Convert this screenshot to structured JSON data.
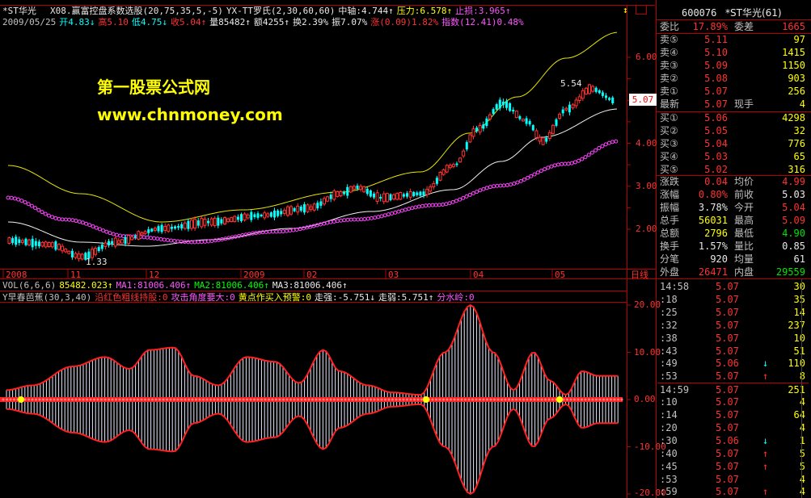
{
  "header": {
    "stock_name": "*ST华光",
    "indicator_line": [
      {
        "text": "X08.赢富控盘系数选股(20,75,35,5,-5)",
        "color": "#e8e8e8"
      },
      {
        "text": "YX-TT罗氏(2,30,60,60)",
        "color": "#e8e8e8"
      },
      {
        "text": "中轴:4.744↑",
        "color": "#e8e8e8"
      },
      {
        "text": "压力:6.578↑",
        "color": "#ffff00"
      },
      {
        "text": "止损:3.965↑",
        "color": "#ff55ff"
      }
    ],
    "ohlc_line": [
      {
        "text": "2009/05/25",
        "color": "#c0c0c0"
      },
      {
        "text": "开4.83↓",
        "color": "#00ffff"
      },
      {
        "text": "高5.10",
        "color": "#ff3232"
      },
      {
        "text": "低4.75↓",
        "color": "#00ffff"
      },
      {
        "text": "收5.04↑",
        "color": "#ff3232"
      },
      {
        "text": "量85482↑",
        "color": "#e8e8e8"
      },
      {
        "text": "额4255↑",
        "color": "#e8e8e8"
      },
      {
        "text": "换2.39%",
        "color": "#e8e8e8"
      },
      {
        "text": "振7.07%",
        "color": "#e8e8e8"
      },
      {
        "text": "涨(0.09)1.82%",
        "color": "#ff3232"
      },
      {
        "text": "指数(12.41)0.48%",
        "color": "#ff55ff"
      }
    ]
  },
  "watermark": {
    "line1": "第一股票公式网",
    "line2": "www.chnmoney.com"
  },
  "price_axis": {
    "labels": [
      "6.00",
      "5.00",
      "4.00",
      "3.00",
      "2.00"
    ],
    "current_price_tag": "5.07",
    "high_marker": "5.54",
    "low_marker": "1.33"
  },
  "date_axis": {
    "labels": [
      "2008",
      "11",
      "12",
      "2009",
      "02",
      "03",
      "04",
      "05"
    ],
    "period_label": "日线"
  },
  "volume_line": [
    {
      "text": "VOL(6,6,6)",
      "color": "#c0c0c0"
    },
    {
      "text": "85482.023↑",
      "color": "#ffff00"
    },
    {
      "text": "MA1:81006.406↑",
      "color": "#ff55ff"
    },
    {
      "text": "MA2:81006.406↑",
      "color": "#00ff00"
    },
    {
      "text": "MA3:81006.406↑",
      "color": "#e8e8e8"
    }
  ],
  "sub_indicator_line": [
    {
      "text": "Y早春芭蕉(30,3,40)",
      "color": "#c0c0c0"
    },
    {
      "text": "沿红色粗线持股:0",
      "color": "#ff3232"
    },
    {
      "text": "攻击角度要大:0",
      "color": "#ff55ff"
    },
    {
      "text": "黄点作买入预警:0",
      "color": "#ffff00"
    },
    {
      "text": "走强:-5.751↓",
      "color": "#e8e8e8"
    },
    {
      "text": "走弱:5.751↑",
      "color": "#e8e8e8"
    },
    {
      "text": "分水岭:0",
      "color": "#ff55ff"
    }
  ],
  "sub_axis": {
    "labels": [
      "20.00",
      "10.00",
      "0.00",
      "-10.00",
      "-20.00"
    ]
  },
  "quote_panel": {
    "code": "600076",
    "name": "*ST华光(61)",
    "weibi_label": "委比",
    "weibi_value": "17.89%",
    "weicha_label": "委差",
    "weicha_value": "1665",
    "asks": [
      {
        "label": "卖⑤",
        "price": "5.11",
        "vol": "97"
      },
      {
        "label": "卖④",
        "price": "5.10",
        "vol": "1415"
      },
      {
        "label": "卖③",
        "price": "5.09",
        "vol": "1150"
      },
      {
        "label": "卖②",
        "price": "5.08",
        "vol": "903"
      },
      {
        "label": "卖①",
        "price": "5.07",
        "vol": "256"
      }
    ],
    "latest_label": "最新",
    "latest_value": "5.07",
    "now_hand_label": "现手",
    "now_hand_value": "4",
    "bids": [
      {
        "label": "买①",
        "price": "5.06",
        "vol": "4298"
      },
      {
        "label": "买②",
        "price": "5.05",
        "vol": "32"
      },
      {
        "label": "买③",
        "price": "5.04",
        "vol": "776"
      },
      {
        "label": "买④",
        "price": "5.03",
        "vol": "65"
      },
      {
        "label": "买⑤",
        "price": "5.02",
        "vol": "316"
      }
    ],
    "stats": [
      {
        "l1": "涨跌",
        "v1": "0.04",
        "c1": "#ff3232",
        "l2": "均价",
        "v2": "4.99",
        "c2": "#ff3232"
      },
      {
        "l1": "涨幅",
        "v1": "0.80%",
        "c1": "#ff3232",
        "l2": "前收",
        "v2": "5.03",
        "c2": "#e8e8e8"
      },
      {
        "l1": "振幅",
        "v1": "3.78%",
        "c1": "#e8e8e8",
        "l2": "今开",
        "v2": "5.04",
        "c2": "#ff3232"
      },
      {
        "l1": "总手",
        "v1": "56031",
        "c1": "#ffff00",
        "l2": "最高",
        "v2": "5.09",
        "c2": "#ff3232"
      },
      {
        "l1": "总额",
        "v1": "2796",
        "c1": "#ffff00",
        "l2": "最低",
        "v2": "4.90",
        "c2": "#00e600"
      },
      {
        "l1": "换手",
        "v1": "1.57%",
        "c1": "#e8e8e8",
        "l2": "量比",
        "v2": "0.85",
        "c2": "#e8e8e8"
      },
      {
        "l1": "分笔",
        "v1": "920",
        "c1": "#e8e8e8",
        "l2": "均量",
        "v2": "61",
        "c2": "#e8e8e8"
      }
    ],
    "outer_label": "外盘",
    "outer_value": "26471",
    "inner_label": "内盘",
    "inner_value": "29559"
  },
  "ticks": [
    {
      "time": "14:58",
      "price": "5.07",
      "arrow": "",
      "vol": "30",
      "color": "#ff3232"
    },
    {
      "time": ":18",
      "price": "5.07",
      "arrow": "",
      "vol": "35",
      "color": "#ff3232"
    },
    {
      "time": ":25",
      "price": "5.07",
      "arrow": "",
      "vol": "14",
      "color": "#ff3232"
    },
    {
      "time": ":32",
      "price": "5.07",
      "arrow": "",
      "vol": "237",
      "color": "#ff3232"
    },
    {
      "time": ":38",
      "price": "5.07",
      "arrow": "",
      "vol": "10",
      "color": "#ff3232"
    },
    {
      "time": ":43",
      "price": "5.07",
      "arrow": "",
      "vol": "51",
      "color": "#ff3232"
    },
    {
      "time": ":49",
      "price": "5.06",
      "arrow": "↓",
      "vol": "110",
      "color": "#ff3232"
    },
    {
      "time": ":53",
      "price": "5.07",
      "arrow": "↑",
      "vol": "8",
      "color": "#ff3232"
    },
    {
      "time": "14:59",
      "price": "5.07",
      "arrow": "",
      "vol": "251",
      "color": "#ff3232"
    },
    {
      "time": ":10",
      "price": "5.07",
      "arrow": "",
      "vol": "4",
      "color": "#ff3232"
    },
    {
      "time": ":14",
      "price": "5.07",
      "arrow": "",
      "vol": "64",
      "color": "#ff3232"
    },
    {
      "time": ":20",
      "price": "5.07",
      "arrow": "",
      "vol": "4",
      "color": "#ff3232"
    },
    {
      "time": ":30",
      "price": "5.06",
      "arrow": "↓",
      "vol": "1",
      "color": "#ff3232"
    },
    {
      "time": ":40",
      "price": "5.07",
      "arrow": "↑",
      "vol": "5",
      "color": "#ff3232"
    },
    {
      "time": ":45",
      "price": "5.07",
      "arrow": "↑",
      "vol": "5",
      "color": "#ff3232"
    },
    {
      "time": ":53",
      "price": "5.07",
      "arrow": "",
      "vol": "4",
      "color": "#ff3232"
    },
    {
      "time": ":59",
      "price": "5.07",
      "arrow": "↑",
      "vol": "4",
      "color": "#ff3232"
    }
  ]
}
